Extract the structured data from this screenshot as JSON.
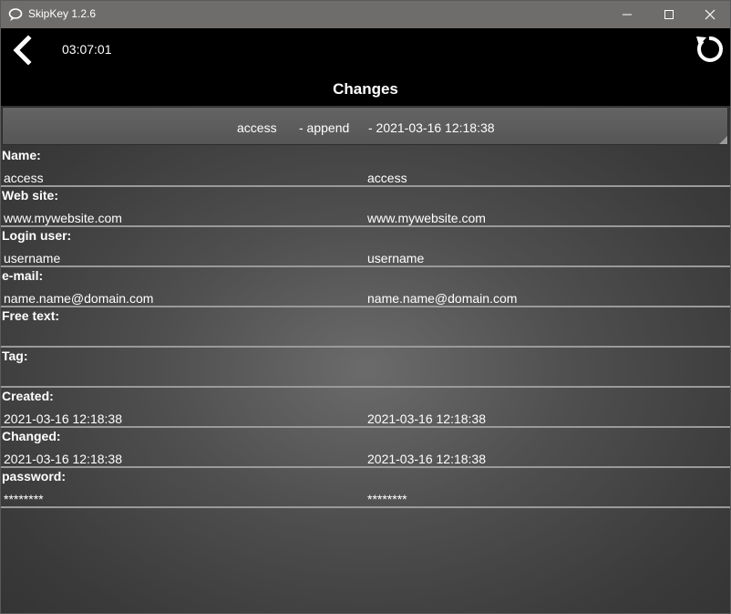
{
  "window": {
    "title": "SkipKey 1.2.6"
  },
  "header": {
    "time": "03:07:01",
    "title": "Changes"
  },
  "history": {
    "name": "access",
    "action": "- append",
    "date": "- 2021-03-16 12:18:38"
  },
  "fields": [
    {
      "label": "Name:",
      "left": "access",
      "right": "access"
    },
    {
      "label": "Web site:",
      "left": "www.mywebsite.com",
      "right": "www.mywebsite.com"
    },
    {
      "label": "Login user:",
      "left": "username",
      "right": "username"
    },
    {
      "label": "e-mail:",
      "left": "name.name@domain.com",
      "right": "name.name@domain.com"
    },
    {
      "label": "Free text:",
      "left": "",
      "right": ""
    },
    {
      "label": "Tag:",
      "left": "",
      "right": ""
    },
    {
      "label": "Created:",
      "left": "2021-03-16 12:18:38",
      "right": "2021-03-16 12:18:38"
    },
    {
      "label": "Changed:",
      "left": "2021-03-16 12:18:38",
      "right": "2021-03-16 12:18:38"
    },
    {
      "label": "password:",
      "left": "********",
      "right": "********"
    }
  ]
}
